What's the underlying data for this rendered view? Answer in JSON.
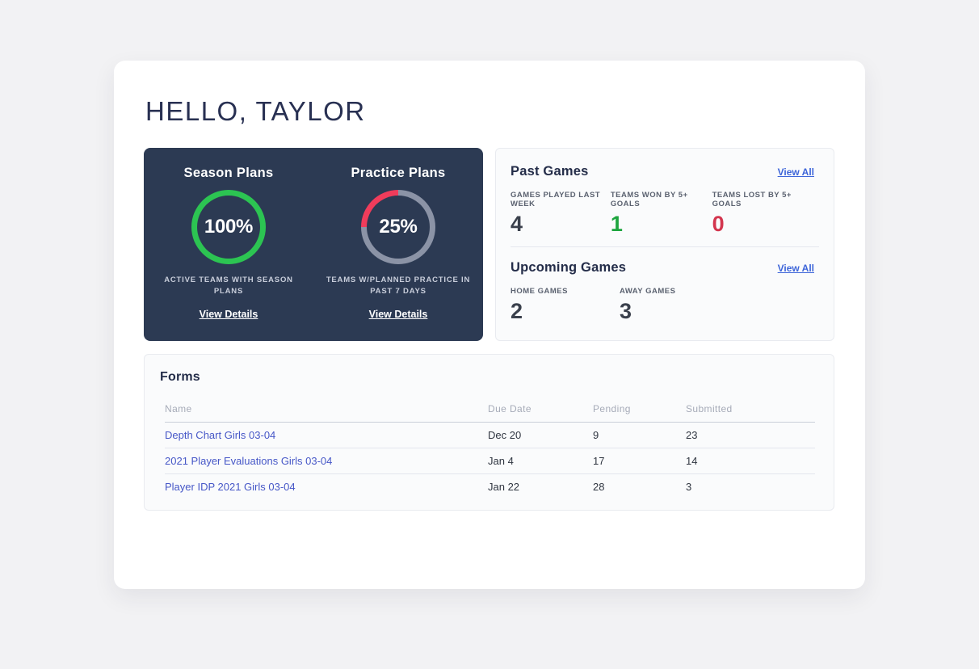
{
  "greeting": "HELLO, TAYLOR",
  "colors": {
    "card_navy": "#2c3a53",
    "accent_green": "#2cc452",
    "accent_red": "#f03c5b",
    "ring_track_gray": "#8b93a6",
    "link_blue": "#3d65d9",
    "link_indigo": "#4657c7"
  },
  "plans_card": {
    "sections": [
      {
        "title": "Season Plans",
        "percent": 100,
        "percent_label": "100%",
        "description": "ACTIVE TEAMS WITH SEASON PLANS",
        "details_link": "View Details",
        "ring_color": "#2cc452",
        "track_color": "#8b93a6"
      },
      {
        "title": "Practice Plans",
        "percent": 25,
        "percent_label": "25%",
        "description": "TEAMS W/PLANNED PRACTICE IN PAST 7 DAYS",
        "details_link": "View Details",
        "ring_color": "#f03c5b",
        "track_color": "#8b93a6"
      }
    ]
  },
  "past_games": {
    "title": "Past Games",
    "view_all_link": "View All",
    "stats": [
      {
        "label": "GAMES PLAYED LAST WEEK",
        "value": "4",
        "color": "#3a404c"
      },
      {
        "label": "TEAMS WON BY 5+ GOALS",
        "value": "1",
        "color": "#1da53e"
      },
      {
        "label": "TEAMS LOST BY 5+ GOALS",
        "value": "0",
        "color": "#d3354e"
      }
    ]
  },
  "upcoming_games": {
    "title": "Upcoming Games",
    "view_all_link": "View All",
    "stats": [
      {
        "label": "HOME GAMES",
        "value": "2",
        "color": "#3a404c"
      },
      {
        "label": "AWAY GAMES",
        "value": "3",
        "color": "#3a404c"
      }
    ]
  },
  "forms": {
    "title": "Forms",
    "columns": [
      "Name",
      "Due Date",
      "Pending",
      "Submitted"
    ],
    "rows": [
      {
        "name": "Depth Chart Girls 03-04",
        "due_date": "Dec 20",
        "pending": "9",
        "submitted": "23"
      },
      {
        "name": "2021 Player Evaluations Girls 03-04",
        "due_date": "Jan 4",
        "pending": "17",
        "submitted": "14"
      },
      {
        "name": "Player IDP 2021 Girls 03-04",
        "due_date": "Jan 22",
        "pending": "28",
        "submitted": "3"
      }
    ]
  }
}
